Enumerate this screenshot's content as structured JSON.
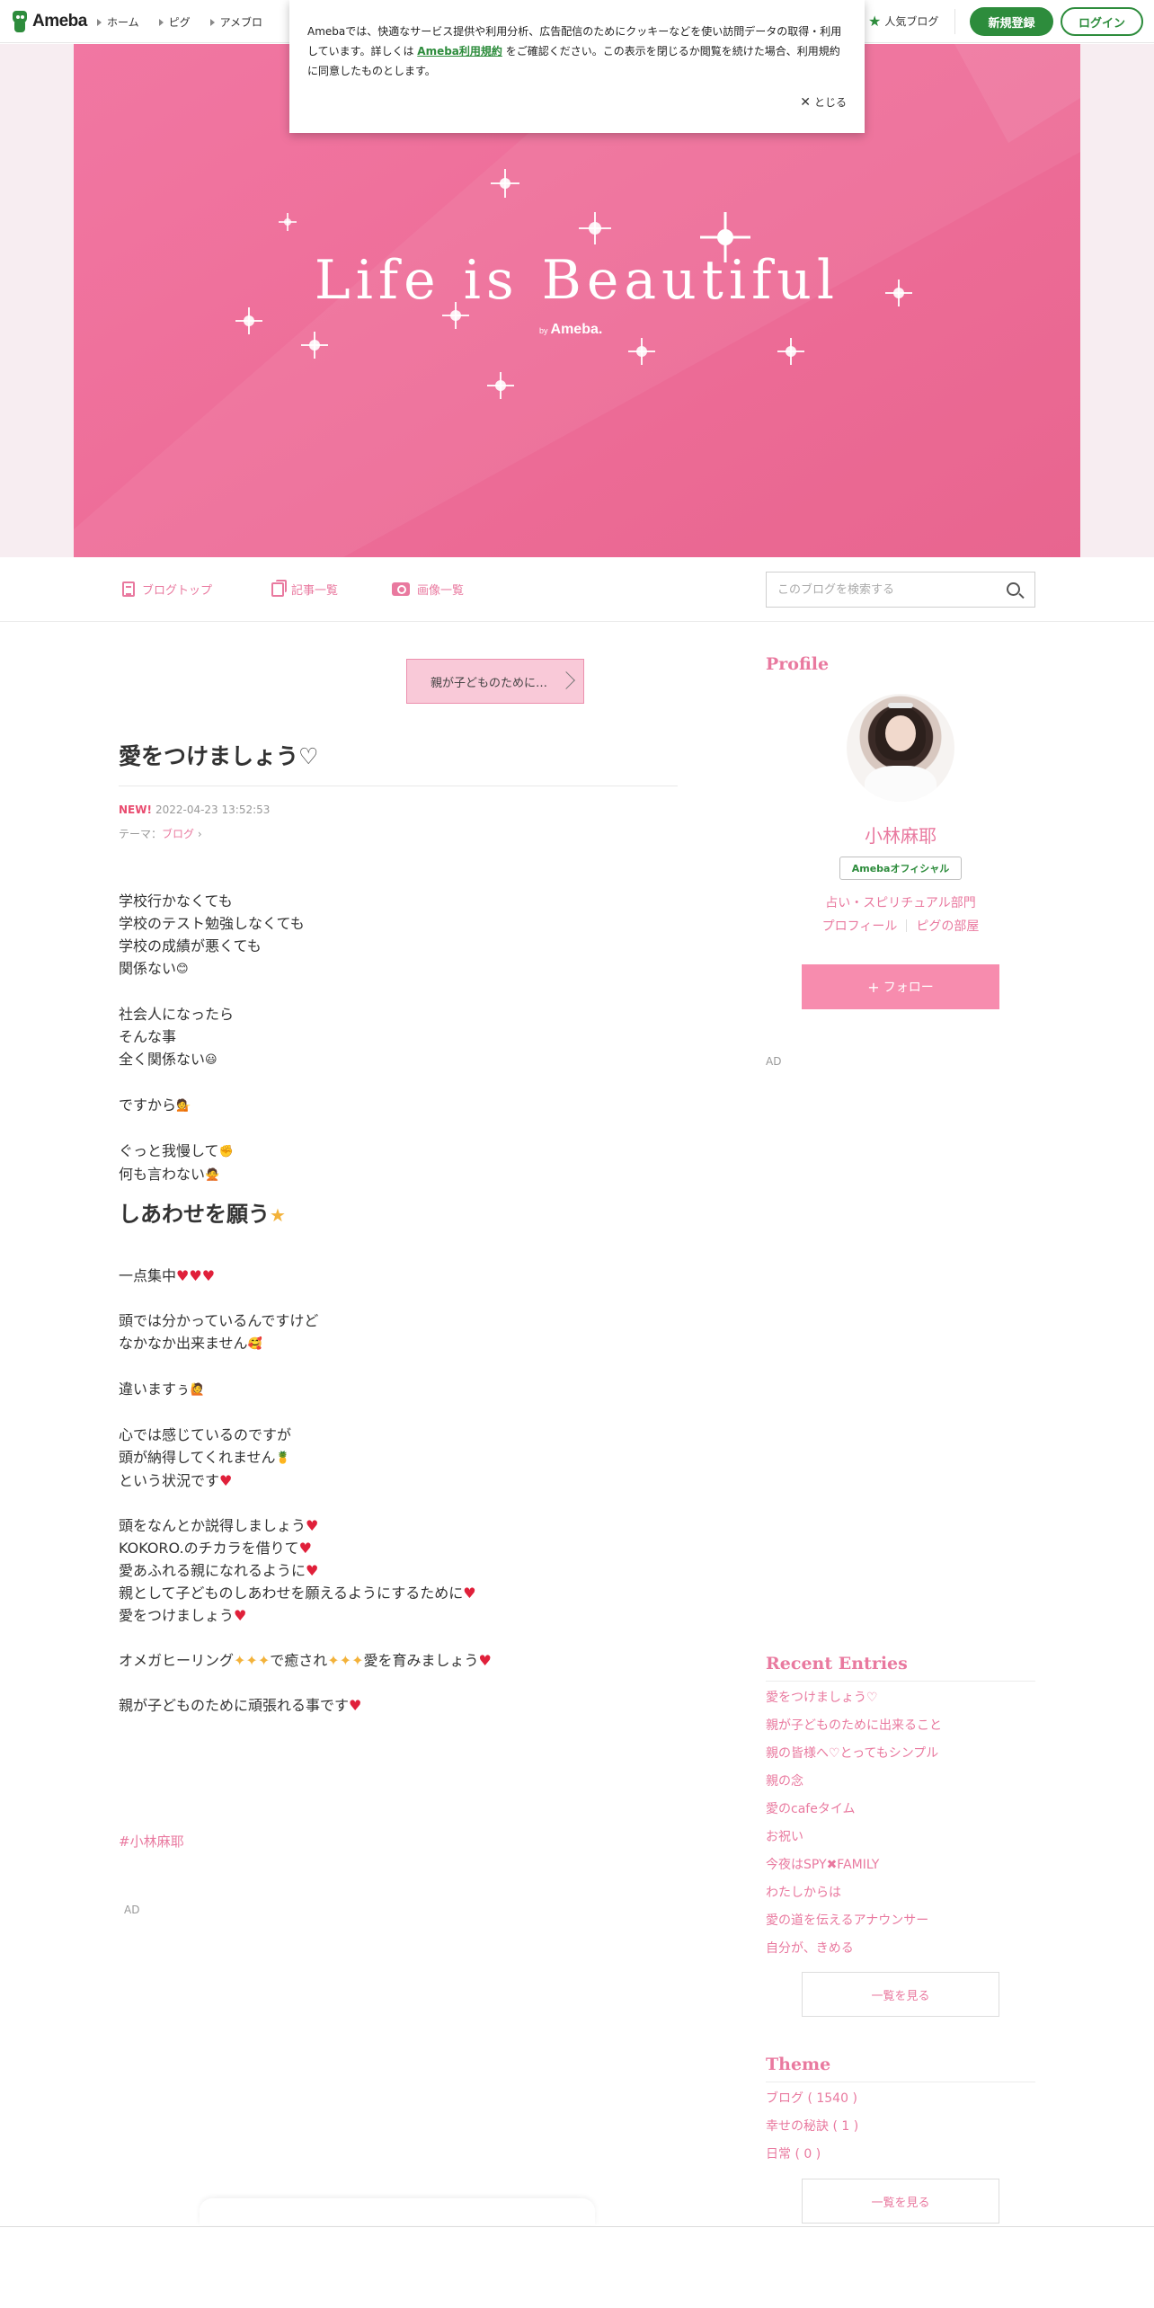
{
  "topbar": {
    "logo_text": "Ameba",
    "nav": [
      "ホーム",
      "ピグ",
      "アメブロ"
    ],
    "popular_label": "人気ブログ",
    "register_label": "新規登録",
    "login_label": "ログイン"
  },
  "cookie": {
    "text_before": "Amebaでは、快適なサービス提供や利用分析、広告配信のためにクッキーなどを使い訪問データの取得・利用しています。詳しくは",
    "link": "Ameba利用規約",
    "text_after": "をご確認ください。この表示を閉じるか閲覧を続けた場合、利用規約に同意したものとします。",
    "close_label": "とじる"
  },
  "banner": {
    "title": "Life is Beautiful",
    "by": "by",
    "brand": "Ameba."
  },
  "blognav": {
    "items": [
      "ブログトップ",
      "記事一覧",
      "画像一覧"
    ],
    "search_placeholder": "このブログを検索する"
  },
  "article": {
    "prev_label": "親が子どものために…",
    "title": "愛をつけましょう♡",
    "new_badge": "NEW!",
    "date": "2022-04-23 13:52:53",
    "theme_prefix": "テーマ：",
    "theme": "ブログ",
    "subheading": "しあわせを願う",
    "hashtag": "#小林麻耶",
    "ad_label": "AD",
    "lines": {
      "p1": [
        "学校行かなくても",
        "学校のテスト勉強しなくても",
        "学校の成績が悪くても",
        "関係ない"
      ],
      "p2": [
        "社会人になったら",
        "そんな事",
        "全く関係ない"
      ],
      "p3": [
        "ですから"
      ],
      "p4": [
        "ぐっと我慢して",
        "何も言わない"
      ],
      "p5": [
        "一点集中"
      ],
      "p6": [
        "頭では分かっているんですけど",
        "なかなか出来ません"
      ],
      "p7": [
        "違いますぅ"
      ],
      "p8": [
        "心では感じているのですが",
        "頭が納得してくれません",
        "という状況です"
      ],
      "p9": [
        "頭をなんとか説得しましょう",
        "KOKORO.のチカラを借りて",
        "愛あふれる親になれるように",
        "親として子どものしあわせを願えるようにするために",
        "愛をつけましょう"
      ],
      "p10a": "オメガヒーリング",
      "p10b": "で癒され",
      "p10c": "愛を育みましょう",
      "p11": [
        "親が子どものために頑張れる事です"
      ]
    }
  },
  "sidebar": {
    "profile_heading": "Profile",
    "name": "小林麻耶",
    "official_badge": "Amebaオフィシャル",
    "category": "占い・スピリチュアル部門",
    "profile_link": "プロフィール",
    "pig_link": "ピグの部屋",
    "follow_label": "フォロー",
    "ad_label": "AD",
    "recent_heading": "Recent Entries",
    "recent": [
      "愛をつけましょう♡",
      "親が子どものために出来ること",
      "親の皆様へ♡とってもシンプル",
      "親の念",
      "愛のcafeタイム",
      "お祝い",
      "今夜はSPY✖FAMILY",
      "わたしからは",
      "愛の道を伝えるアナウンサー",
      "自分が、きめる"
    ],
    "more_label": "一覧を見る",
    "theme_heading": "Theme",
    "themes": [
      "ブログ ( 1540 )",
      "幸せの秘訣 ( 1 )",
      "日常 ( 0 )"
    ],
    "more_label2": "一覧を見る"
  },
  "colors": {
    "accent_pink": "#e9799f",
    "ameba_green": "#2d8c3c",
    "banner_pink": "#ee6e99"
  }
}
